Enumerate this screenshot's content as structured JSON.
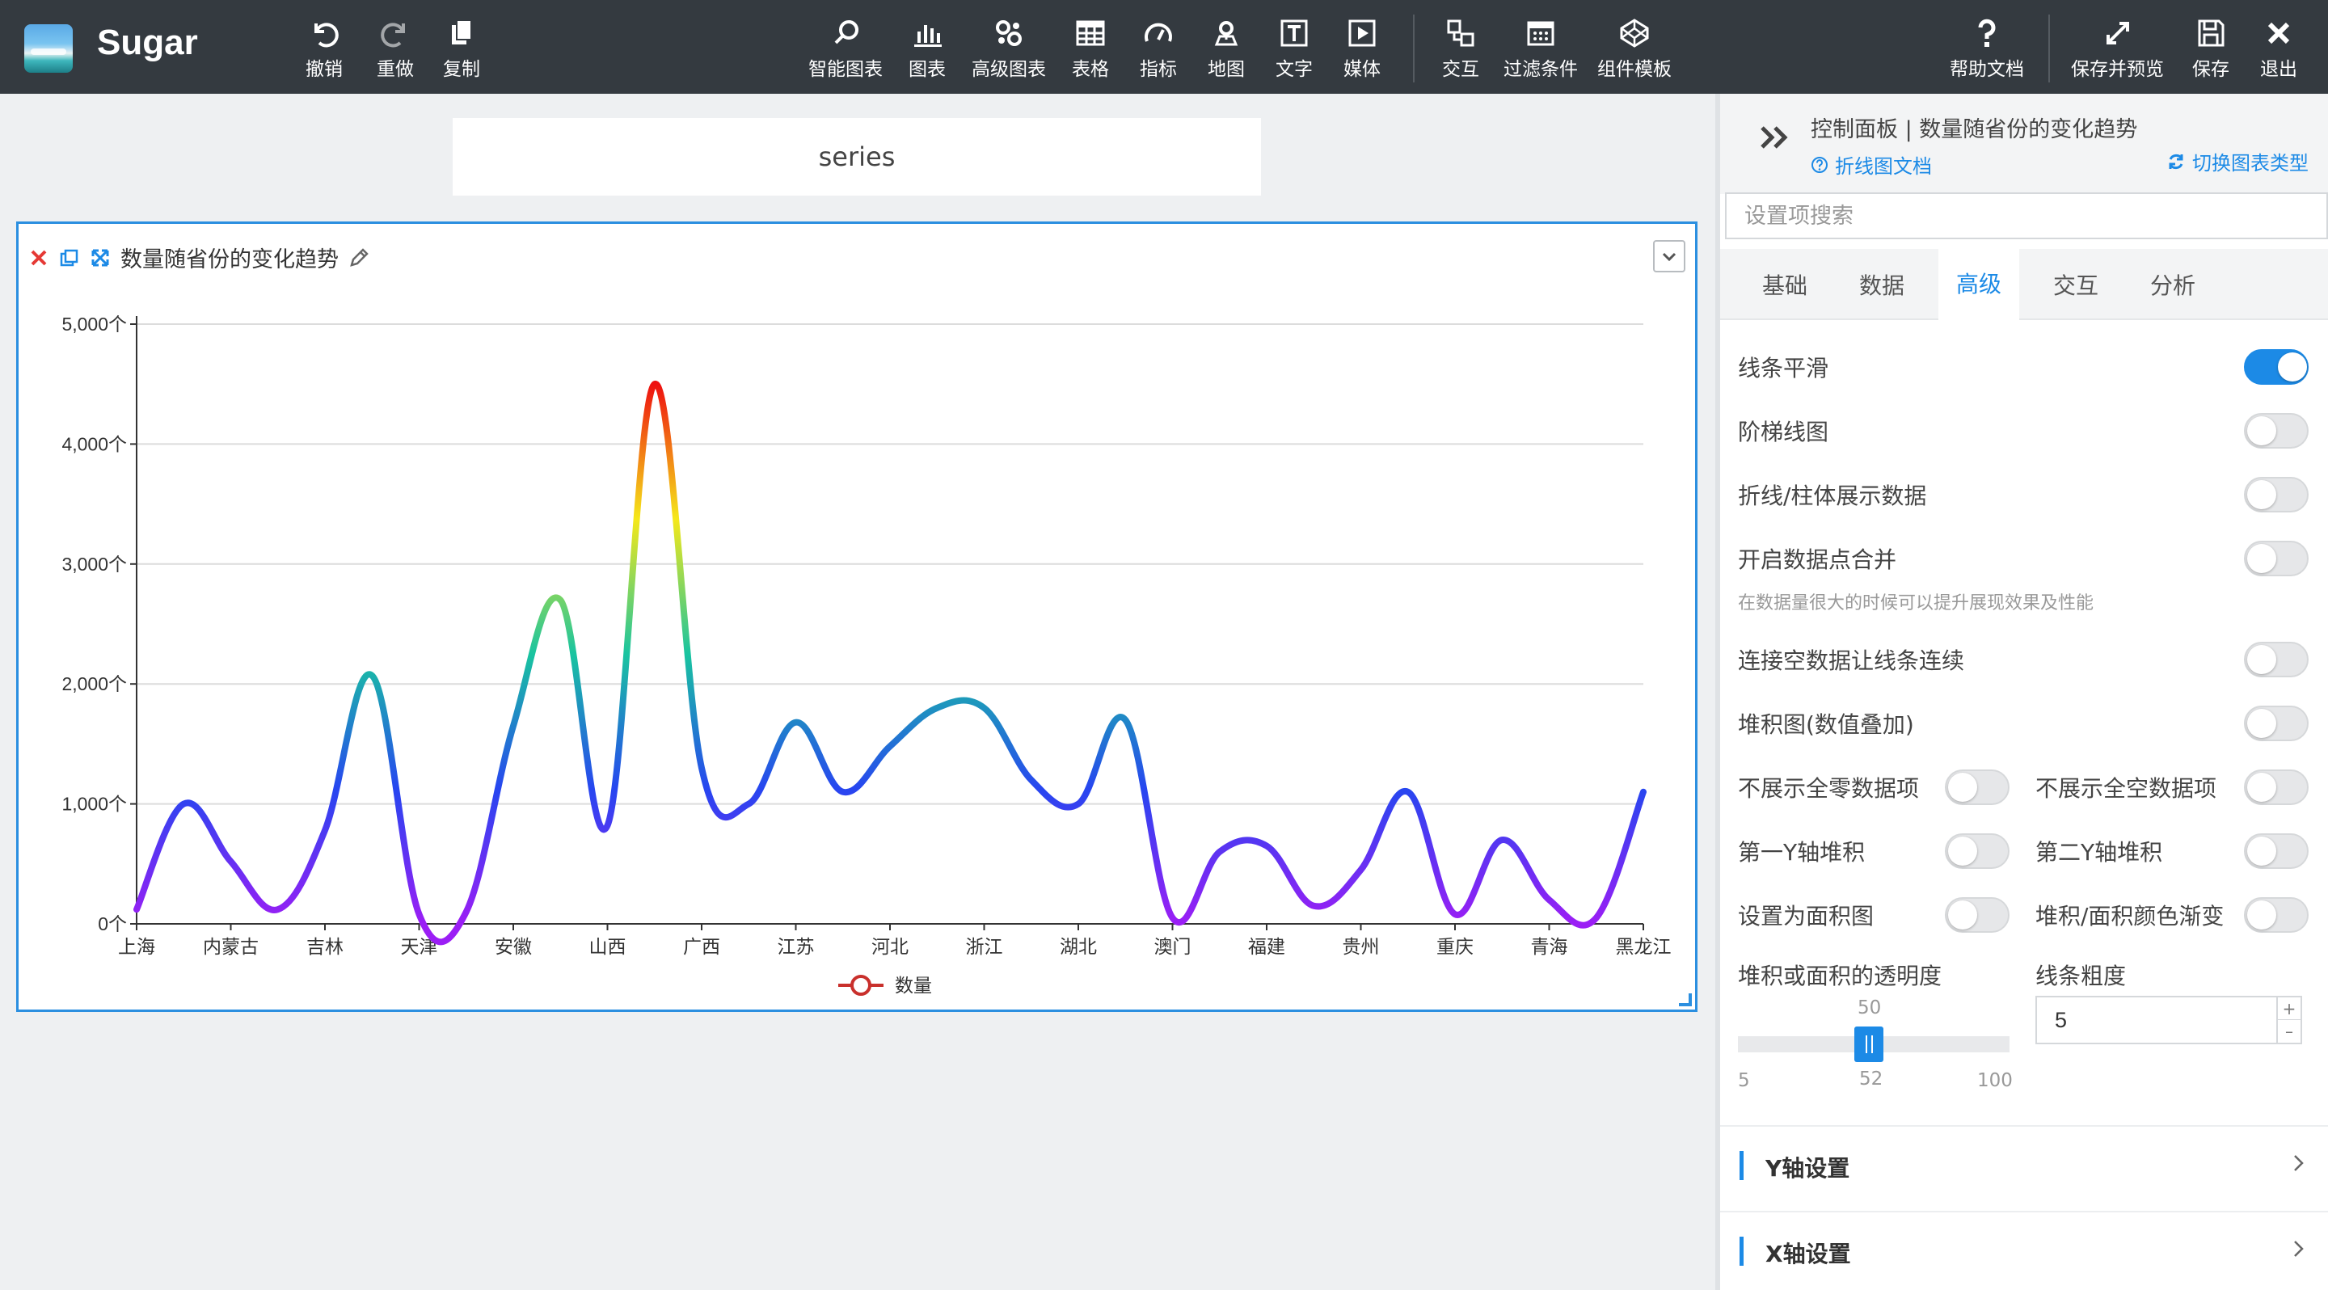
{
  "app": {
    "name": "Sugar"
  },
  "toolbar": {
    "left": [
      {
        "label": "撤销",
        "icon": "undo-icon"
      },
      {
        "label": "重做",
        "icon": "redo-icon"
      },
      {
        "label": "复制",
        "icon": "copy-icon"
      }
    ],
    "center": [
      {
        "label": "智能图表",
        "icon": "smart-chart-icon"
      },
      {
        "label": "图表",
        "icon": "bar-chart-icon"
      },
      {
        "label": "高级图表",
        "icon": "advanced-chart-icon"
      },
      {
        "label": "表格",
        "icon": "table-icon"
      },
      {
        "label": "指标",
        "icon": "gauge-icon"
      },
      {
        "label": "地图",
        "icon": "map-pin-icon"
      },
      {
        "label": "文字",
        "icon": "text-icon"
      },
      {
        "label": "媒体",
        "icon": "media-play-icon"
      },
      {
        "label": "交互",
        "icon": "interaction-icon"
      },
      {
        "label": "过滤条件",
        "icon": "filter-calendar-icon"
      },
      {
        "label": "组件模板",
        "icon": "template-icon"
      }
    ],
    "right": [
      {
        "label": "帮助文档",
        "icon": "help-icon"
      },
      {
        "label": "保存并预览",
        "icon": "expand-icon"
      },
      {
        "label": "保存",
        "icon": "save-icon"
      },
      {
        "label": "退出",
        "icon": "close-icon"
      }
    ]
  },
  "canvas": {
    "series_text": "series",
    "panel_title": "数量随省份的变化趋势"
  },
  "chart_data": {
    "type": "line",
    "smooth": true,
    "gradient_by_value": [
      "#9b1ef5",
      "#2746f0",
      "#19c4a0",
      "#f5e81a",
      "#ee1010"
    ],
    "categories": [
      "上海",
      "内蒙古",
      "吉林",
      "天津",
      "安徽",
      "山西",
      "广西",
      "江苏",
      "河北",
      "浙江",
      "湖北",
      "澳门",
      "福建",
      "贵州",
      "重庆",
      "青海",
      "黑龙江"
    ],
    "x_points": [
      0,
      0.5,
      1,
      1.5,
      2,
      2.5,
      3,
      3.5,
      4,
      4.5,
      5,
      5.5,
      6,
      6.5,
      7,
      7.5,
      8,
      8.5,
      9,
      9.5,
      10,
      10.5,
      11,
      11.5,
      12,
      12.5,
      13,
      13.5,
      14,
      14.5,
      15,
      15.5,
      16
    ],
    "values": [
      120,
      1000,
      520,
      120,
      780,
      2070,
      80,
      100,
      1650,
      2700,
      820,
      4500,
      1300,
      1000,
      1680,
      1100,
      1480,
      1800,
      1800,
      1200,
      1000,
      1700,
      50,
      600,
      650,
      150,
      450,
      1100,
      80,
      700,
      200,
      50,
      1100
    ],
    "series": [
      {
        "name": "数量"
      }
    ],
    "ylim": [
      0,
      5000
    ],
    "yticks": [
      "0个",
      "1,000个",
      "2,000个",
      "3,000个",
      "4,000个",
      "5,000个"
    ],
    "legend": "bottom-center",
    "grid": true
  },
  "panel": {
    "title": "控制面板 | 数量随省份的变化趋势",
    "doc_link": "折线图文档",
    "switch_link": "切换图表类型",
    "search_placeholder": "设置项搜索",
    "tabs": [
      "基础",
      "数据",
      "高级",
      "交互",
      "分析"
    ],
    "active_tab": "高级",
    "options": [
      {
        "label": "线条平滑",
        "on": true
      },
      {
        "label": "阶梯线图",
        "on": false
      },
      {
        "label": "折线/柱体展示数据",
        "on": false
      },
      {
        "label": "开启数据点合并",
        "on": false
      },
      {
        "label": "连接空数据让线条连续",
        "on": false
      },
      {
        "label": "堆积图(数值叠加)",
        "on": false
      }
    ],
    "merge_hint": "在数据量很大的时候可以提升展现效果及性能",
    "pair_options": [
      {
        "label": "不展示全零数据项",
        "on": false
      },
      {
        "label": "不展示全空数据项",
        "on": false
      },
      {
        "label": "第一Y轴堆积",
        "on": false
      },
      {
        "label": "第二Y轴堆积",
        "on": false
      },
      {
        "label": "设置为面积图",
        "on": false
      },
      {
        "label": "堆积/面积颜色渐变",
        "on": false
      }
    ],
    "opacity_label": "堆积或面积的透明度",
    "opacity_value": "50",
    "opacity_min": "5",
    "opacity_mid": "52",
    "opacity_max": "100",
    "linewidth_label": "线条粗度",
    "linewidth_value": "5",
    "sections": [
      "Y轴设置",
      "X轴设置"
    ]
  }
}
